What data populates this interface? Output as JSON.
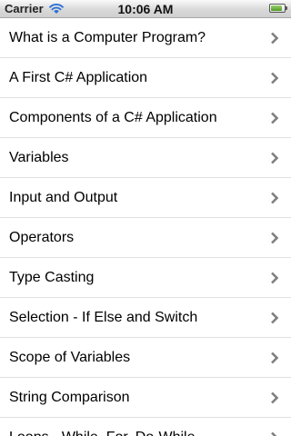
{
  "status_bar": {
    "carrier": "Carrier",
    "time": "10:06 AM",
    "wifi_icon": "wifi-icon",
    "battery_icon": "battery-icon",
    "battery_level": 0.85
  },
  "menu": {
    "items": [
      {
        "label": "What is a Computer Program?",
        "icon": "chevron-right-icon"
      },
      {
        "label": "A First C# Application",
        "icon": "chevron-right-icon"
      },
      {
        "label": "Components of a C# Application",
        "icon": "chevron-right-icon"
      },
      {
        "label": "Variables",
        "icon": "chevron-right-icon"
      },
      {
        "label": "Input and Output",
        "icon": "chevron-right-icon"
      },
      {
        "label": "Operators",
        "icon": "chevron-right-icon"
      },
      {
        "label": "Type Casting",
        "icon": "chevron-right-icon"
      },
      {
        "label": "Selection - If Else and Switch",
        "icon": "chevron-right-icon"
      },
      {
        "label": "Scope of Variables",
        "icon": "chevron-right-icon"
      },
      {
        "label": "String Comparison",
        "icon": "chevron-right-icon"
      },
      {
        "label": "Loops - While, For, Do-While",
        "icon": "chevron-right-icon"
      }
    ]
  }
}
